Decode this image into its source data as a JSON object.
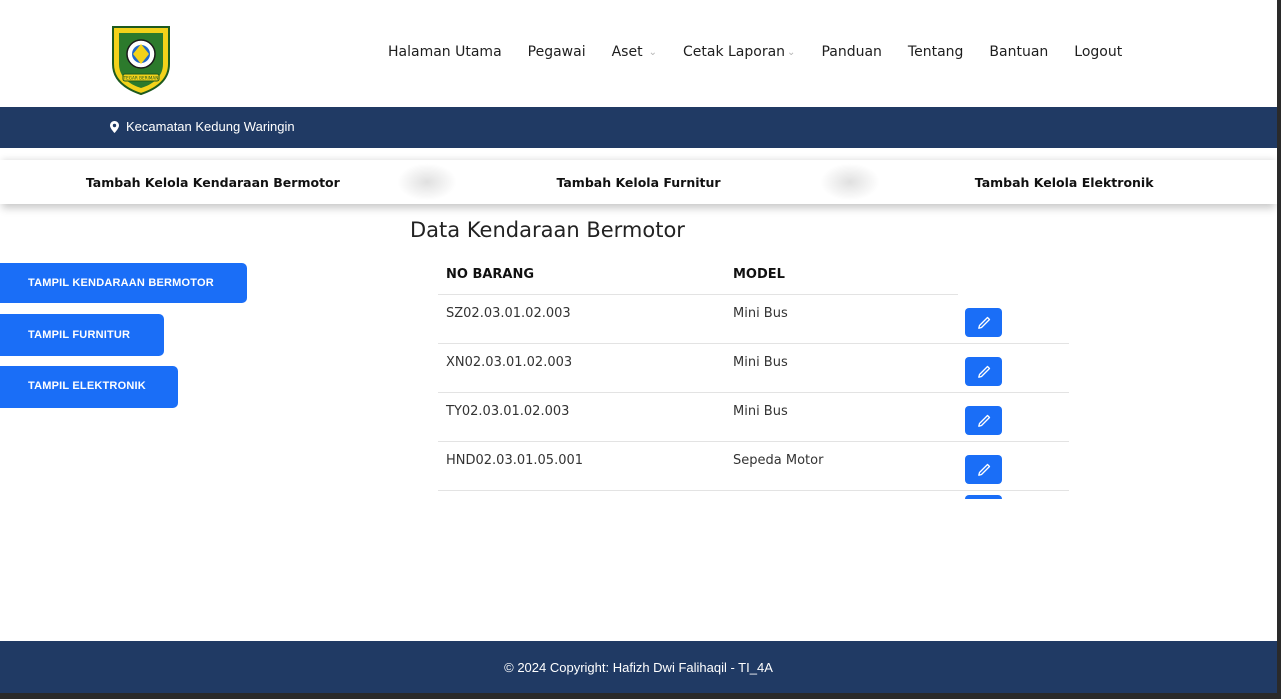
{
  "header": {
    "logo_icon": "regency-crest-logo",
    "logo_text": "TEGAR BERIMAN",
    "nav": [
      {
        "label": "Halaman Utama",
        "dropdown": false
      },
      {
        "label": "Pegawai",
        "dropdown": false
      },
      {
        "label": "Aset",
        "dropdown": true
      },
      {
        "label": "Cetak Laporan",
        "dropdown": true
      },
      {
        "label": "Panduan",
        "dropdown": false
      },
      {
        "label": "Tentang",
        "dropdown": false
      },
      {
        "label": "Bantuan",
        "dropdown": false
      },
      {
        "label": "Logout",
        "dropdown": false
      }
    ]
  },
  "topbar": {
    "location_icon": "map-pin-icon",
    "location": "Kecamatan Kedung Waringin"
  },
  "tabs": [
    "Tambah Kelola Kendaraan Bermotor",
    "Tambah Kelola Furnitur",
    "Tambah Kelola Elektronik"
  ],
  "sidebar": {
    "buttons": [
      "TAMPIL KENDARAAN BERMOTOR",
      "TAMPIL FURNITUR",
      "TAMPIL ELEKTRONIK"
    ]
  },
  "main": {
    "title": "Data Kendaraan Bermotor",
    "columns": [
      "NO BARANG",
      "MODEL"
    ],
    "rows": [
      {
        "no_barang": "SZ02.03.01.02.003",
        "model": "Mini Bus"
      },
      {
        "no_barang": "XN02.03.01.02.003",
        "model": "Mini Bus"
      },
      {
        "no_barang": "TY02.03.01.02.003",
        "model": "Mini Bus"
      },
      {
        "no_barang": "HND02.03.01.05.001",
        "model": "Sepeda Motor"
      }
    ],
    "edit_icon": "pencil-icon"
  },
  "footer": {
    "copyright": "© 2024 Copyright: Hafizh Dwi Falihaqil - TI_4A"
  },
  "colors": {
    "navy": "#203a64",
    "primary": "#1a6ef7"
  }
}
